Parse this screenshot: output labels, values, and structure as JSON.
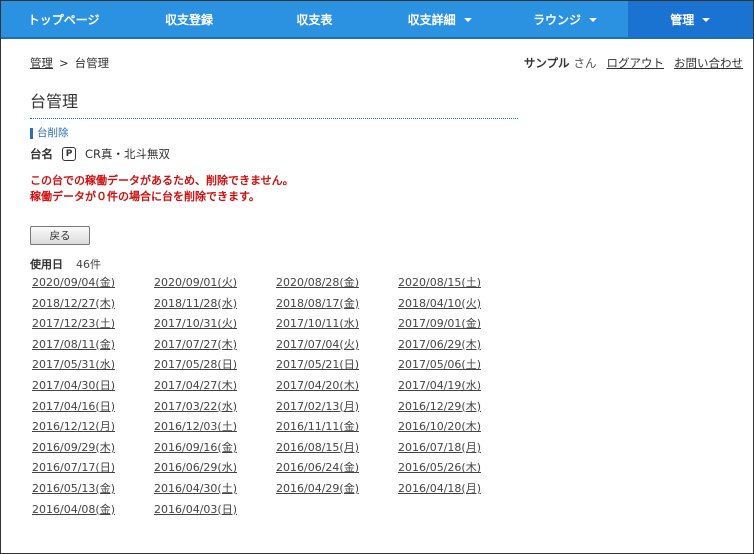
{
  "nav": {
    "items": [
      {
        "label": "トップページ",
        "caret": false,
        "active": false
      },
      {
        "label": "収支登録",
        "caret": false,
        "active": false
      },
      {
        "label": "収支表",
        "caret": false,
        "active": false
      },
      {
        "label": "収支詳細",
        "caret": true,
        "active": false
      },
      {
        "label": "ラウンジ",
        "caret": true,
        "active": false
      },
      {
        "label": "管理",
        "caret": true,
        "active": true
      }
    ]
  },
  "breadcrumb": {
    "parent": "管理",
    "separator": ">",
    "current": "台管理"
  },
  "user": {
    "name": "サンプル",
    "suffix": "さん",
    "logout": "ログアウト",
    "contact": "お問い合わせ"
  },
  "page": {
    "title": "台管理",
    "section": "台削除"
  },
  "stand": {
    "label": "台名",
    "badge": "P",
    "name": "CR真・北斗無双"
  },
  "error": {
    "line1": "この台での稼働データがあるため、削除できません。",
    "line2": "稼働データが０件の場合に台を削除できます。"
  },
  "back_button": "戻る",
  "usage": {
    "label": "使用日",
    "count": "46件"
  },
  "dates": [
    "2020/09/04(金)",
    "2020/09/01(火)",
    "2020/08/28(金)",
    "2020/08/15(土)",
    "2018/12/27(木)",
    "2018/11/28(水)",
    "2018/08/17(金)",
    "2018/04/10(火)",
    "2017/12/23(土)",
    "2017/10/31(火)",
    "2017/10/11(水)",
    "2017/09/01(金)",
    "2017/08/11(金)",
    "2017/07/27(木)",
    "2017/07/04(火)",
    "2017/06/29(木)",
    "2017/05/31(水)",
    "2017/05/28(日)",
    "2017/05/21(日)",
    "2017/05/06(土)",
    "2017/04/30(日)",
    "2017/04/27(木)",
    "2017/04/20(木)",
    "2017/04/19(水)",
    "2017/04/16(日)",
    "2017/03/22(水)",
    "2017/02/13(月)",
    "2016/12/29(木)",
    "2016/12/12(月)",
    "2016/12/03(土)",
    "2016/11/11(金)",
    "2016/10/20(木)",
    "2016/09/29(木)",
    "2016/09/16(金)",
    "2016/08/15(月)",
    "2016/07/18(月)",
    "2016/07/17(日)",
    "2016/06/29(水)",
    "2016/06/24(金)",
    "2016/05/26(木)",
    "2016/05/13(金)",
    "2016/04/30(土)",
    "2016/04/29(金)",
    "2016/04/18(月)",
    "2016/04/08(金)",
    "2016/04/03(日)"
  ]
}
